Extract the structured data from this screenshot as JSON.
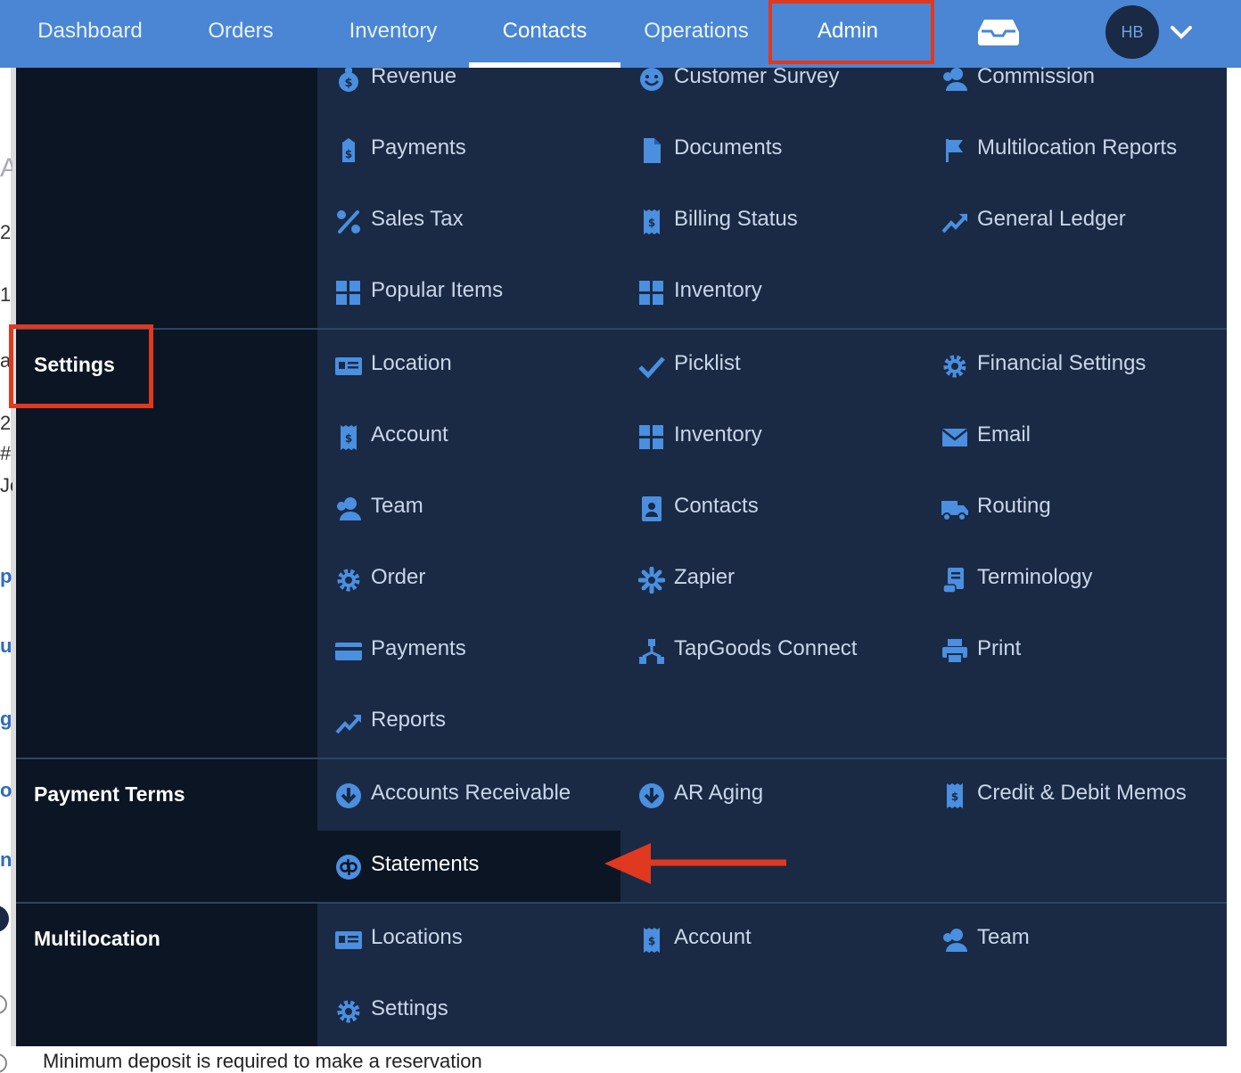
{
  "nav": {
    "items": [
      "Dashboard",
      "Orders",
      "Inventory",
      "Contacts",
      "Operations",
      "Admin"
    ],
    "active": "Contacts",
    "highlighted": "Admin",
    "avatar_initials": "HB"
  },
  "background": {
    "fragments": [
      "A",
      "2",
      "1",
      "ar",
      "2",
      "#",
      "Jo",
      "p",
      "ue",
      "g",
      "o",
      "n"
    ],
    "bottom_text": "Minimum deposit is required to make a reservation"
  },
  "menu": {
    "reports_section": {
      "items": [
        {
          "label": "Revenue",
          "icon": "money-bag-icon"
        },
        {
          "label": "Customer Survey",
          "icon": "smile-icon"
        },
        {
          "label": "Commission",
          "icon": "users-icon"
        },
        {
          "label": "Payments",
          "icon": "price-tag-icon"
        },
        {
          "label": "Documents",
          "icon": "document-icon"
        },
        {
          "label": "Multilocation Reports",
          "icon": "flag-icon"
        },
        {
          "label": "Sales Tax",
          "icon": "percent-icon"
        },
        {
          "label": "Billing Status",
          "icon": "receipt-icon"
        },
        {
          "label": "General Ledger",
          "icon": "trend-up-icon"
        },
        {
          "label": "Popular Items",
          "icon": "grid-icon"
        },
        {
          "label": "Inventory",
          "icon": "grid-icon"
        }
      ]
    },
    "settings_section": {
      "label": "Settings",
      "items": [
        {
          "label": "Location",
          "icon": "id-card-icon"
        },
        {
          "label": "Picklist",
          "icon": "check-icon"
        },
        {
          "label": "Financial Settings",
          "icon": "gear-icon"
        },
        {
          "label": "Account",
          "icon": "receipt-icon"
        },
        {
          "label": "Inventory",
          "icon": "grid-icon"
        },
        {
          "label": "Email",
          "icon": "envelope-icon"
        },
        {
          "label": "Team",
          "icon": "users-icon"
        },
        {
          "label": "Contacts",
          "icon": "contact-book-icon"
        },
        {
          "label": "Routing",
          "icon": "truck-icon"
        },
        {
          "label": "Order",
          "icon": "gear-icon"
        },
        {
          "label": "Zapier",
          "icon": "asterisk-icon"
        },
        {
          "label": "Terminology",
          "icon": "scroll-icon"
        },
        {
          "label": "Payments",
          "icon": "credit-card-icon"
        },
        {
          "label": "TapGoods Connect",
          "icon": "network-icon"
        },
        {
          "label": "Print",
          "icon": "printer-icon"
        },
        {
          "label": "Reports",
          "icon": "trend-up-icon"
        }
      ]
    },
    "payment_terms_section": {
      "label": "Payment Terms",
      "items": [
        {
          "label": "Accounts Receivable",
          "icon": "arrow-down-circle-icon"
        },
        {
          "label": "AR Aging",
          "icon": "arrow-down-circle-icon"
        },
        {
          "label": "Credit & Debit Memos",
          "icon": "receipt-icon"
        },
        {
          "label": "Statements",
          "icon": "quickbooks-icon"
        }
      ]
    },
    "multilocation_section": {
      "label": "Multilocation",
      "items": [
        {
          "label": "Locations",
          "icon": "id-card-icon"
        },
        {
          "label": "Account",
          "icon": "receipt-icon"
        },
        {
          "label": "Team",
          "icon": "users-icon"
        },
        {
          "label": "Settings",
          "icon": "gear-icon"
        }
      ]
    }
  },
  "colors": {
    "nav_bg": "#4a86d4",
    "menu_bg": "#1a2a44",
    "label_col_bg": "#0c1523",
    "icon_blue": "#4a8fe0",
    "annotation_red": "#e0391f"
  }
}
